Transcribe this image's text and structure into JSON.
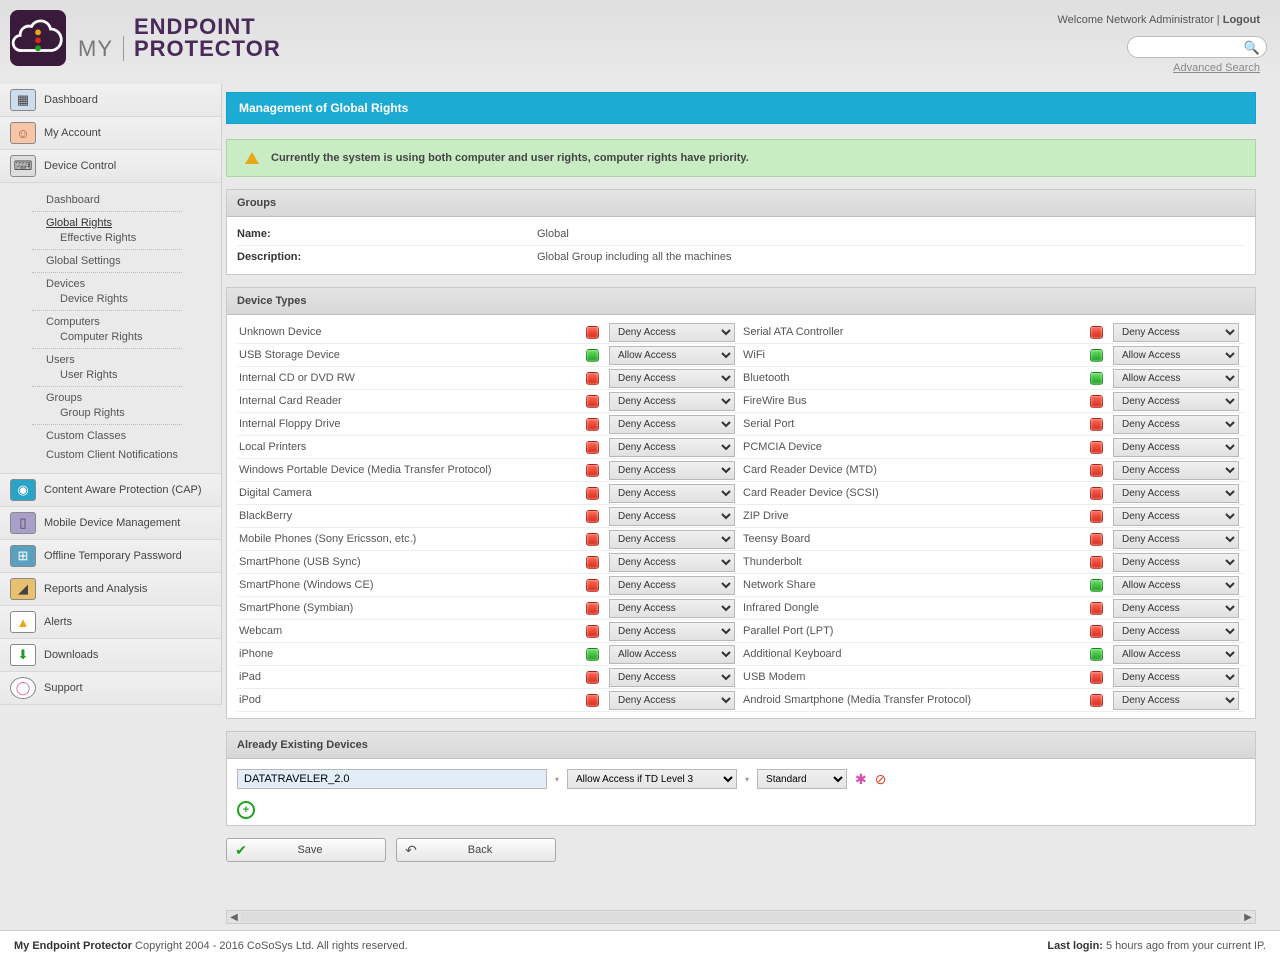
{
  "header": {
    "brand_my": "MY",
    "brand_line1": "ENDPOINT",
    "brand_line2": "PROTECTOR",
    "welcome_prefix": "Welcome ",
    "welcome_user": "Network Administrator",
    "sep": " | ",
    "logout": "Logout",
    "adv_search": "Advanced Search",
    "search_placeholder": ""
  },
  "nav": {
    "dashboard": "Dashboard",
    "my_account": "My Account",
    "device_control": "Device Control",
    "cap": "Content Aware Protection (CAP)",
    "mdm": "Mobile Device Management",
    "otp": "Offline Temporary Password",
    "reports": "Reports and Analysis",
    "alerts": "Alerts",
    "downloads": "Downloads",
    "support": "Support"
  },
  "subnav": {
    "dashboard": "Dashboard",
    "global_rights": "Global Rights",
    "effective_rights": "Effective Rights",
    "global_settings": "Global Settings",
    "devices": "Devices",
    "device_rights": "Device Rights",
    "computers": "Computers",
    "computer_rights": "Computer Rights",
    "users": "Users",
    "user_rights": "User Rights",
    "groups": "Groups",
    "group_rights": "Group Rights",
    "custom_classes": "Custom Classes",
    "custom_notif": "Custom Client Notifications"
  },
  "page": {
    "title": "Management of Global Rights",
    "notice": "Currently the system is using both computer and user rights, computer rights have priority."
  },
  "groups_panel": {
    "title": "Groups",
    "name_label": "Name:",
    "name_value": "Global",
    "desc_label": "Description:",
    "desc_value": "Global Group including all the machines"
  },
  "devtypes": {
    "title": "Device Types",
    "left": [
      {
        "name": "Unknown Device",
        "access": "Deny Access",
        "allow": false
      },
      {
        "name": "USB Storage Device",
        "access": "Allow Access",
        "allow": true
      },
      {
        "name": "Internal CD or DVD RW",
        "access": "Deny Access",
        "allow": false
      },
      {
        "name": "Internal Card Reader",
        "access": "Deny Access",
        "allow": false
      },
      {
        "name": "Internal Floppy Drive",
        "access": "Deny Access",
        "allow": false
      },
      {
        "name": "Local Printers",
        "access": "Deny Access",
        "allow": false
      },
      {
        "name": "Windows Portable Device (Media Transfer Protocol)",
        "access": "Deny Access",
        "allow": false
      },
      {
        "name": "Digital Camera",
        "access": "Deny Access",
        "allow": false
      },
      {
        "name": "BlackBerry",
        "access": "Deny Access",
        "allow": false
      },
      {
        "name": "Mobile Phones (Sony Ericsson, etc.)",
        "access": "Deny Access",
        "allow": false
      },
      {
        "name": "SmartPhone (USB Sync)",
        "access": "Deny Access",
        "allow": false
      },
      {
        "name": "SmartPhone (Windows CE)",
        "access": "Deny Access",
        "allow": false
      },
      {
        "name": "SmartPhone (Symbian)",
        "access": "Deny Access",
        "allow": false
      },
      {
        "name": "Webcam",
        "access": "Deny Access",
        "allow": false
      },
      {
        "name": "iPhone",
        "access": "Allow Access",
        "allow": true
      },
      {
        "name": "iPad",
        "access": "Deny Access",
        "allow": false
      },
      {
        "name": "iPod",
        "access": "Deny Access",
        "allow": false
      }
    ],
    "right": [
      {
        "name": "Serial ATA Controller",
        "access": "Deny Access",
        "allow": false
      },
      {
        "name": "WiFi",
        "access": "Allow Access",
        "allow": true
      },
      {
        "name": "Bluetooth",
        "access": "Allow Access",
        "allow": true
      },
      {
        "name": "FireWire Bus",
        "access": "Deny Access",
        "allow": false
      },
      {
        "name": "Serial Port",
        "access": "Deny Access",
        "allow": false
      },
      {
        "name": "PCMCIA Device",
        "access": "Deny Access",
        "allow": false
      },
      {
        "name": "Card Reader Device (MTD)",
        "access": "Deny Access",
        "allow": false
      },
      {
        "name": "Card Reader Device (SCSI)",
        "access": "Deny Access",
        "allow": false
      },
      {
        "name": "ZIP Drive",
        "access": "Deny Access",
        "allow": false
      },
      {
        "name": "Teensy Board",
        "access": "Deny Access",
        "allow": false
      },
      {
        "name": "Thunderbolt",
        "access": "Deny Access",
        "allow": false
      },
      {
        "name": "Network Share",
        "access": "Allow Access",
        "allow": true
      },
      {
        "name": "Infrared Dongle",
        "access": "Deny Access",
        "allow": false
      },
      {
        "name": "Parallel Port (LPT)",
        "access": "Deny Access",
        "allow": false
      },
      {
        "name": "Additional Keyboard",
        "access": "Allow Access",
        "allow": true
      },
      {
        "name": "USB Modem",
        "access": "Deny Access",
        "allow": false
      },
      {
        "name": "Android Smartphone (Media Transfer Protocol)",
        "access": "Deny Access",
        "allow": false
      }
    ]
  },
  "existing": {
    "title": "Already Existing Devices",
    "device_name": "DATATRAVELER_2.0",
    "access_sel": "Allow Access if TD Level 3",
    "mode_sel": "Standard"
  },
  "buttons": {
    "save": "Save",
    "back": "Back"
  },
  "footer": {
    "left_bold": "My Endpoint Protector",
    "left_rest": " Copyright 2004 - 2016 CoSoSys Ltd. All rights reserved.",
    "right_bold": "Last login:",
    "right_rest": " 5 hours ago from your current IP."
  }
}
